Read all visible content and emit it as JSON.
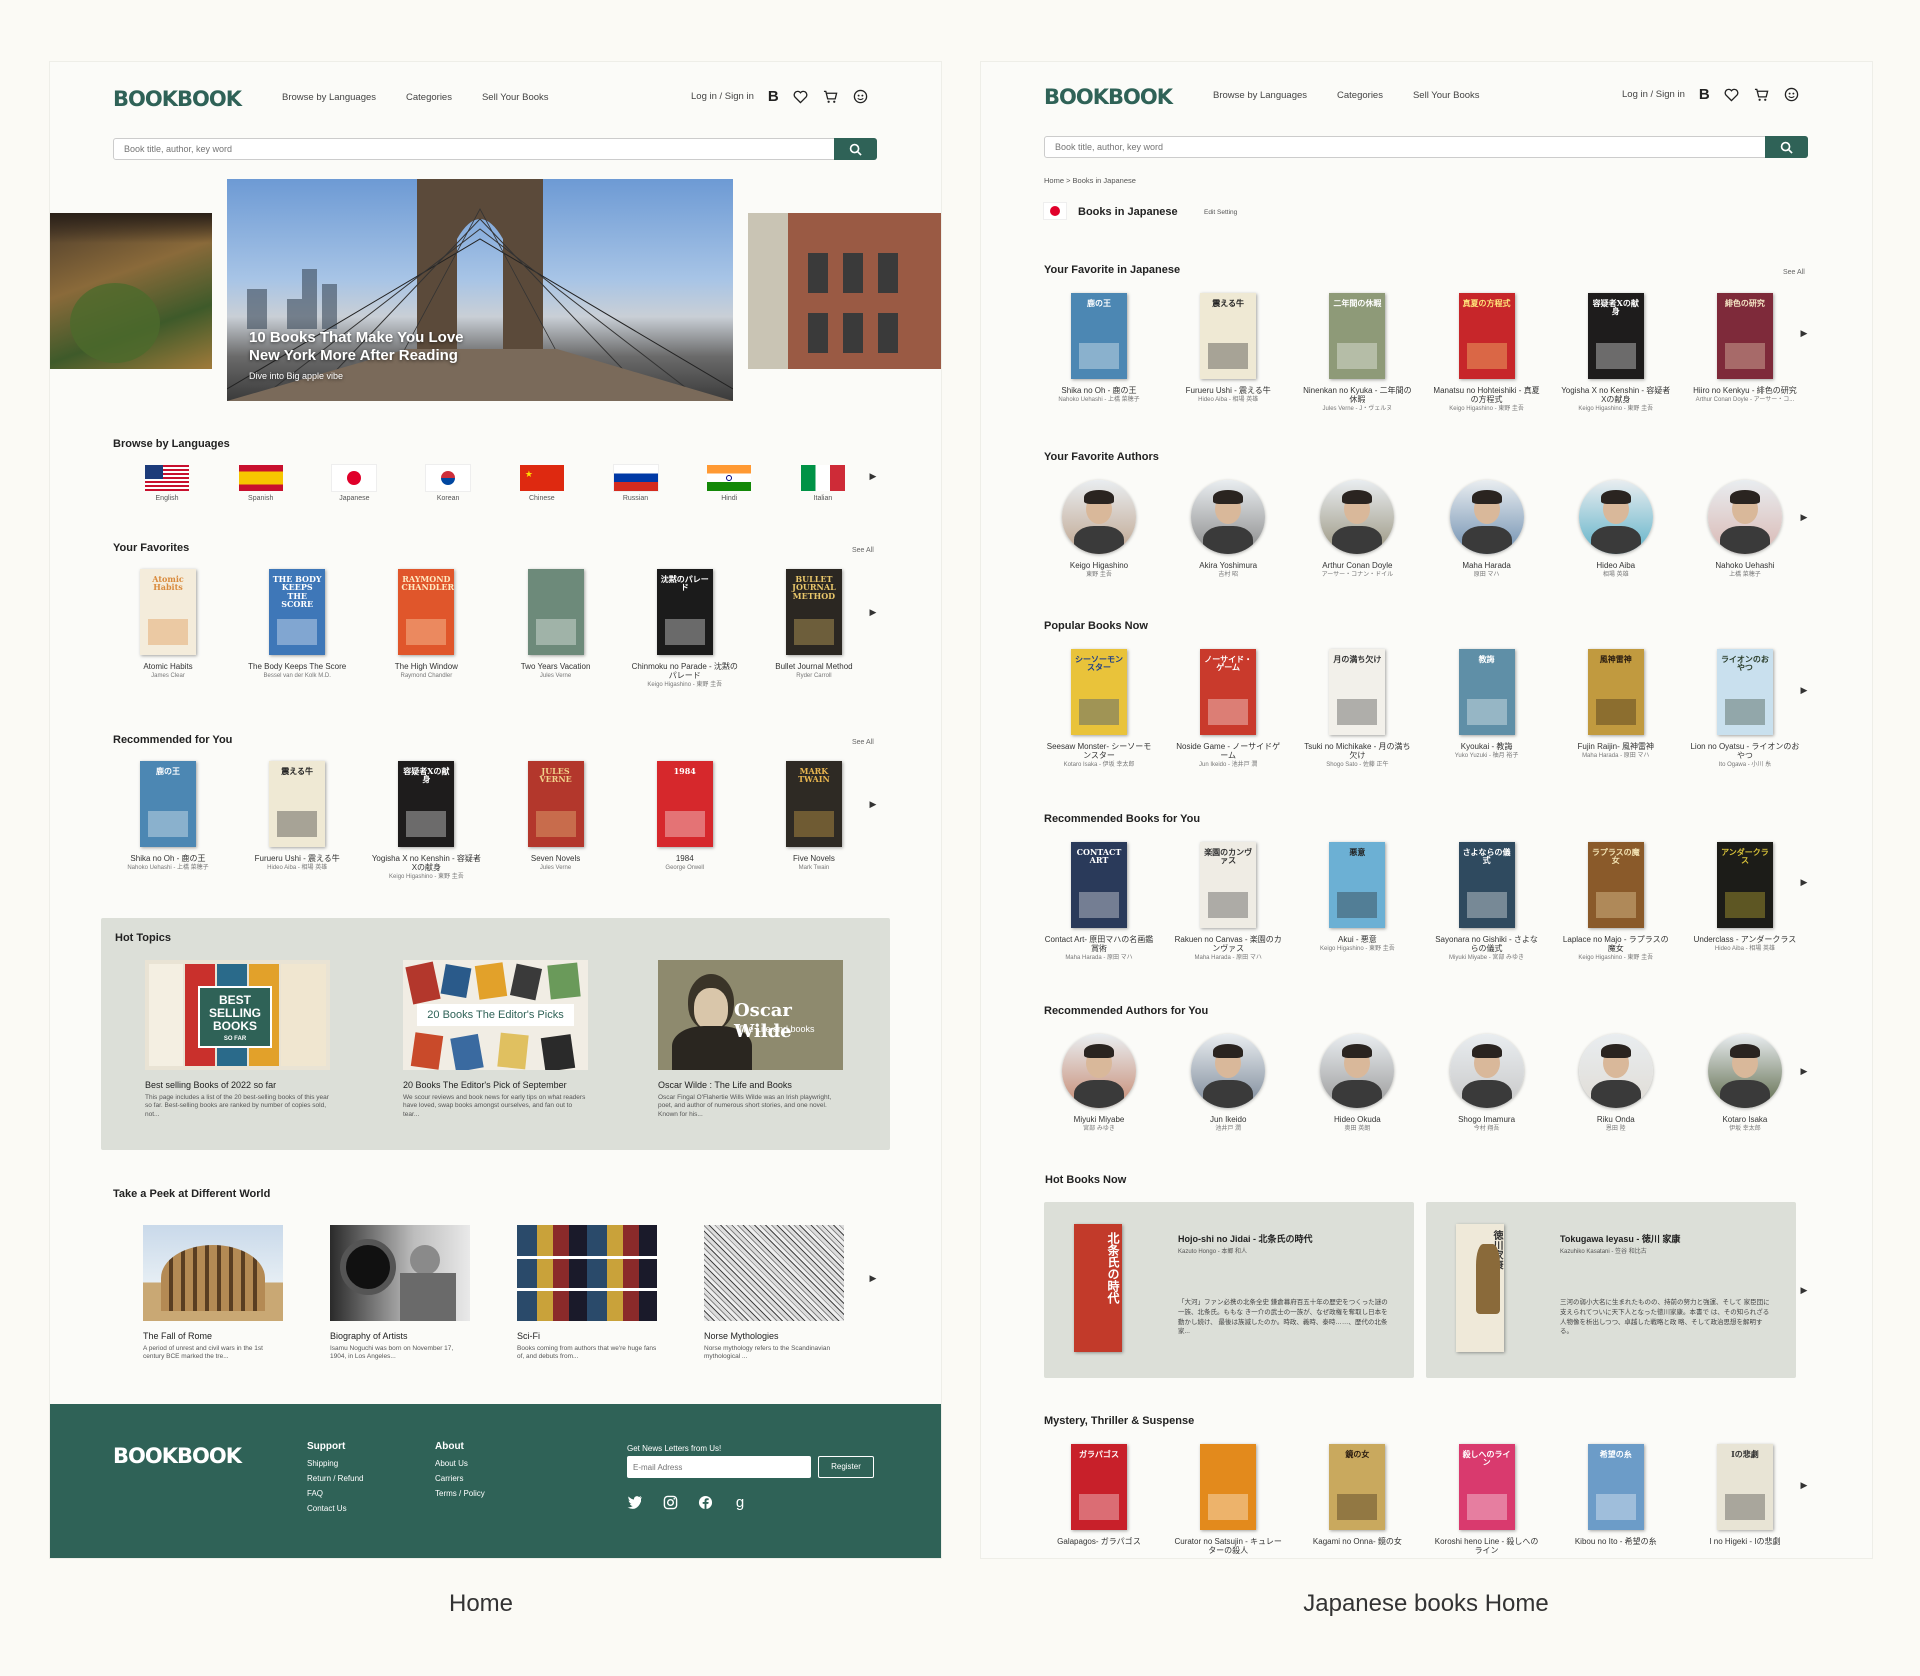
{
  "brand": "BOOKBOOK",
  "nav": {
    "browse": "Browse by Languages",
    "categories": "Categories",
    "sell": "Sell Your Books"
  },
  "util": {
    "login": "Log in / Sign in",
    "b": "B"
  },
  "search": {
    "placeholder": "Book title, author, key word"
  },
  "home": {
    "hero": {
      "title_l1": "10 Books That Make You Love",
      "title_l2": "New York More After Reading",
      "subtitle": "Dive into Big apple vibe"
    },
    "languages_title": "Browse by Languages",
    "languages": [
      "English",
      "Spanish",
      "Japanese",
      "Korean",
      "Chinese",
      "Russian",
      "Hindi",
      "Italian"
    ],
    "favorites_title": "Your Favorites",
    "see_all": "See All",
    "favorites": [
      {
        "title": "Atomic Habits",
        "author": "James Clear",
        "cover": "Atomic Habits",
        "bg": "#f4ecdb",
        "fg": "#d98a3c"
      },
      {
        "title": "The Body Keeps The Score",
        "author": "Bessel van der Kolk M.D.",
        "cover": "THE BODY KEEPS THE SCORE",
        "bg": "#3e77b8",
        "fg": "#ffffff"
      },
      {
        "title": "The High Window",
        "author": "Raymond Chandler",
        "cover": "RAYMOND CHANDLER",
        "bg": "#e0562b",
        "fg": "#ffe9c0"
      },
      {
        "title": "Two Years Vacation",
        "author": "Jules Verne",
        "cover": "",
        "bg": "#6d8a7a",
        "fg": "#ffffff"
      },
      {
        "title": "Chinmoku no Parade - 沈黙のパレード",
        "author": "Keigo Higashino - 東野 圭吾",
        "cover": "沈黙のパレード",
        "bg": "#1b1b1b",
        "fg": "#ffffff"
      },
      {
        "title": "Bullet Journal Method",
        "author": "Ryder Carroll",
        "cover": "BULLET JOURNAL METHOD",
        "bg": "#2b2722",
        "fg": "#e8c66a"
      }
    ],
    "recommended_title": "Recommended for You",
    "recommended": [
      {
        "title": "Shika no Oh - 鹿の王",
        "author": "Nahoko Uehashi - 上橋 菜穂子",
        "cover": "鹿の王",
        "bg": "#4c87b3",
        "fg": "#ffffff"
      },
      {
        "title": "Furueru Ushi - 震える牛",
        "author": "Hideo Aiba - 相場 英雄",
        "cover": "震える牛",
        "bg": "#efe9d4",
        "fg": "#222222"
      },
      {
        "title": "Yogisha X no Kenshin - 容疑者Xの献身",
        "author": "Keigo Higashino - 東野 圭吾",
        "cover": "容疑者Xの献身",
        "bg": "#1e1c1c",
        "fg": "#ffffff"
      },
      {
        "title": "Seven Novels",
        "author": "Jules Verne",
        "cover": "JULES VERNE",
        "bg": "#b3372c",
        "fg": "#f1d18a"
      },
      {
        "title": "1984",
        "author": "George Orwell",
        "cover": "1984",
        "bg": "#d6282c",
        "fg": "#ffffff"
      },
      {
        "title": "Five Novels",
        "author": "Mark Twain",
        "cover": "MARK TWAIN",
        "bg": "#2e2a24",
        "fg": "#e9b650"
      }
    ],
    "hot_topics_title": "Hot Topics",
    "hot_topics": [
      {
        "title": "Best selling Books of 2022 so far",
        "desc": "This page includes a list of the 20 best-selling books of this year so far. Best-selling books are ranked by number of copies sold, not...",
        "badge_l1": "BEST",
        "badge_l2": "SELLING",
        "badge_l3": "BOOKS",
        "badge_l4": "SO FAR"
      },
      {
        "title": "20 Books The Editor's Pick of September",
        "desc": "We scour reviews and book news for early tips on what readers have loved, swap books amongst ourselves, and fan out to tear...",
        "badge": "20 Books The Editor's Picks"
      },
      {
        "title": "Oscar Wilde : The Life and Books",
        "desc": "Oscar Fingal O'Flahertie Wills Wilde was an Irish playwright, poet, and author of numerous short stories, and one novel. Known for his...",
        "badge": "Oscar Wilde",
        "badge_sub": "The Life and books"
      }
    ],
    "peek_title": "Take a Peek at Different World",
    "peek": [
      {
        "title": "The Fall of Rome",
        "desc": "A period of unrest and civil wars in the 1st century BCE marked the tre..."
      },
      {
        "title": "Biography of Artists",
        "desc": "Isamu Noguchi was born on November 17, 1904, in Los Angeles..."
      },
      {
        "title": "Sci-Fi",
        "desc": "Books coming from authors that we're huge fans of, and debuts from..."
      },
      {
        "title": "Norse Mythologies",
        "desc": "Norse mythology refers to the Scandinavian mythological ..."
      }
    ],
    "footer": {
      "support": {
        "title": "Support",
        "items": [
          "Shipping",
          "Return / Refund",
          "FAQ",
          "Contact Us"
        ]
      },
      "about": {
        "title": "About",
        "items": [
          "About Us",
          "Carriers",
          "Terms / Policy"
        ]
      },
      "news": "Get News Letters from Us!",
      "email_placeholder": "E-mail Adress",
      "register": "Register"
    }
  },
  "jp": {
    "breadcrumb": "Home > Books in Japanese",
    "page_title": "Books in Japanese",
    "edit": "Edit Setting",
    "see_all": "See All",
    "fav_title": "Your Favorite in Japanese",
    "fav": [
      {
        "title": "Shika no Oh - 鹿の王",
        "author": "Nahoko Uehashi - 上橋 菜穂子",
        "cover": "鹿の王",
        "bg": "#4c87b3",
        "fg": "#ffffff"
      },
      {
        "title": "Furueru Ushi - 震える牛",
        "author": "Hideo Aiba - 相場 英雄",
        "cover": "震える牛",
        "bg": "#efe9d4",
        "fg": "#222222"
      },
      {
        "title": "Ninenkan no Kyuka - 二年間の休暇",
        "author": "Jules Verne - J・ヴェルヌ",
        "cover": "二年間の休暇",
        "bg": "#8e9a78",
        "fg": "#ffffff"
      },
      {
        "title": "Manatsu no Hohteishiki - 真夏の方程式",
        "author": "Keigo Higashino - 東野 圭吾",
        "cover": "真夏の方程式",
        "bg": "#c7262a",
        "fg": "#ffe27a"
      },
      {
        "title": "Yogisha X no Kenshin - 容疑者Xの献身",
        "author": "Keigo Higashino - 東野 圭吾",
        "cover": "容疑者Xの献身",
        "bg": "#1e1c1c",
        "fg": "#ffffff"
      },
      {
        "title": "Hiiro no Kenkyu - 緋色の研究",
        "author": "Arthur Conan Doyle - アーサー・コ...",
        "cover": "緋色の研究",
        "bg": "#7e2a3a",
        "fg": "#f3e3c3"
      }
    ],
    "fav_authors_title": "Your Favorite Authors",
    "fav_authors": [
      {
        "name": "Keigo Higashino",
        "jp": "東野 圭吾",
        "c": "#bfa58f"
      },
      {
        "name": "Akira Yoshimura",
        "jp": "吉村 昭",
        "c": "#8a8a8a"
      },
      {
        "name": "Arthur Conan Doyle",
        "jp": "アーサー・コナン・ドイル",
        "c": "#9a9580"
      },
      {
        "name": "Maha Harada",
        "jp": "原田 マハ",
        "c": "#6f8fb0"
      },
      {
        "name": "Hideo Aiba",
        "jp": "相場 英雄",
        "c": "#5fb2c8"
      },
      {
        "name": "Nahoko Uehashi",
        "jp": "上橋 菜穂子",
        "c": "#d9b8b3"
      }
    ],
    "popular_title": "Popular Books Now",
    "popular": [
      {
        "title": "Seesaw Monster- シーソーモンスター",
        "author": "Kotaro Isaka - 伊坂 幸太郎",
        "cover": "シーソーモンスター",
        "bg": "#e9c33a",
        "fg": "#1b3d8a"
      },
      {
        "title": "Noside Game - ノーサイドゲーム",
        "author": "Jun Ikeido - 池井戸 潤",
        "cover": "ノーサイド・ゲーム",
        "bg": "#c93a2c",
        "fg": "#ffffff"
      },
      {
        "title": "Tsuki no Michikake - 月の満ち欠け",
        "author": "Shogo Sato - 佐藤 正午",
        "cover": "月の満ち欠け",
        "bg": "#f2f0ea",
        "fg": "#333333"
      },
      {
        "title": "Kyoukai - 教誨",
        "author": "Yuko Yuzuki - 柚月 裕子",
        "cover": "教誨",
        "bg": "#5f8fa7",
        "fg": "#ffffff"
      },
      {
        "title": "Fujin Raijin- 風神雷神",
        "author": "Maha Harada - 原田 マハ",
        "cover": "風神雷神",
        "bg": "#c19a3f",
        "fg": "#2a1c10"
      },
      {
        "title": "Lion no Oyatsu - ライオンのおやつ",
        "author": "Ito Ogawa - 小川 糸",
        "cover": "ライオンのおやつ",
        "bg": "#c9e0ee",
        "fg": "#2a3d2a"
      }
    ],
    "rec_title": "Recommended Books for You",
    "rec": [
      {
        "title": "Contact Art- 原田マハの名画鑑賞術",
        "author": "Maha Harada - 原田 マハ",
        "cover": "CONTACT ART",
        "bg": "#2a3a5a",
        "fg": "#ffffff"
      },
      {
        "title": "Rakuen no Canvas - 楽園のカンヴァス",
        "author": "Maha Harada - 原田 マハ",
        "cover": "楽園のカンヴァス",
        "bg": "#efece4",
        "fg": "#333333"
      },
      {
        "title": "Akui - 悪意",
        "author": "Keigo Higashino - 東野 圭吾",
        "cover": "悪意",
        "bg": "#6cb0d4",
        "fg": "#222222"
      },
      {
        "title": "Sayonara no Gishiki - さよならの儀式",
        "author": "Miyuki Miyabe - 宮部 みゆき",
        "cover": "さよならの儀式",
        "bg": "#2f4a5f",
        "fg": "#ffffff"
      },
      {
        "title": "Laplace no Majo - ラプラスの魔女",
        "author": "Keigo Higashino - 東野 圭吾",
        "cover": "ラプラスの魔女",
        "bg": "#8a5a2a",
        "fg": "#f3e3b3"
      },
      {
        "title": "Underclass - アンダークラス",
        "author": "Hideo Aiba - 相場 英雄",
        "cover": "アンダークラス",
        "bg": "#1c1c18",
        "fg": "#d8c23a"
      }
    ],
    "rec_authors_title": "Recommended Authors for You",
    "rec_authors": [
      {
        "name": "Miyuki Miyabe",
        "jp": "宮部 みゆき",
        "c": "#c68a72"
      },
      {
        "name": "Jun Ikeido",
        "jp": "池井戸 潤",
        "c": "#7b8898"
      },
      {
        "name": "Hideo Okuda",
        "jp": "奥田 英朗",
        "c": "#9a9a9a"
      },
      {
        "name": "Shogo Imamura",
        "jp": "今村 翔吾",
        "c": "#c8c8c8"
      },
      {
        "name": "Riku Onda",
        "jp": "恩田 陸",
        "c": "#e0dcd5"
      },
      {
        "name": "Kotaro Isaka",
        "jp": "伊坂 幸太郎",
        "c": "#5d6a4a"
      }
    ],
    "hot_title": "Hot Books Now",
    "hot": [
      {
        "title": "Hojo-shi no Jidai - 北条氏の時代",
        "author": "Kazuto Hongo - 本郷 和人",
        "desc": "「大河」ファン必携の北条全史 鎌倉幕府百五十年の歴史をつくった謎の一族、北条氏。ももな き一介の武士の一族が、なぜ政権を奪取し日本を動かし続け、 最後は族滅したのか。時政、義時、泰時……、歴代の北条家...",
        "cover": "北条氏の時代",
        "bg": "#c23a2a",
        "fg": "#ffffff"
      },
      {
        "title": "Tokugawa Ieyasu - 徳川 家康",
        "author": "Kazuhiko Kasatani - 笠谷 和比古",
        "desc": "三河の弱小大名に生まれたものの、持前の努力と強運、そして 家臣団に支えられてついに天下人となった徳川家康。本書で は、その知られざる人物像を析出しつつ、卓越した戦略と政 略、そして政治思想を解明する。",
        "cover": "徳川家康",
        "bg": "#efe9d9",
        "fg": "#333333"
      }
    ],
    "mystery_title": "Mystery, Thriller & Suspense",
    "mystery": [
      {
        "title": "Galapagos- ガラパゴス",
        "author": "",
        "cover": "ガラパゴス",
        "bg": "#c8202a",
        "fg": "#ffffff"
      },
      {
        "title": "Curator no Satsujin - キュレーターの殺人",
        "author": "",
        "cover": "",
        "bg": "#e38a1c",
        "fg": "#ffffff"
      },
      {
        "title": "Kagami no Onna- 鏡の女",
        "author": "",
        "cover": "鏡の女",
        "bg": "#c9a95e",
        "fg": "#2a1c10"
      },
      {
        "title": "Koroshi heno Line - 殺しへのライン",
        "author": "",
        "cover": "殺しへのライン",
        "bg": "#d93a6e",
        "fg": "#ffffff"
      },
      {
        "title": "Kibou no Ito - 希望の糸",
        "author": "",
        "cover": "希望の糸",
        "bg": "#6c9cc8",
        "fg": "#ffffff"
      },
      {
        "title": "I no Higeki - Iの悲劇",
        "author": "",
        "cover": "Iの悲劇",
        "bg": "#e8e4d5",
        "fg": "#333333"
      }
    ]
  },
  "captions": {
    "home": "Home",
    "jp": "Japanese books Home"
  }
}
